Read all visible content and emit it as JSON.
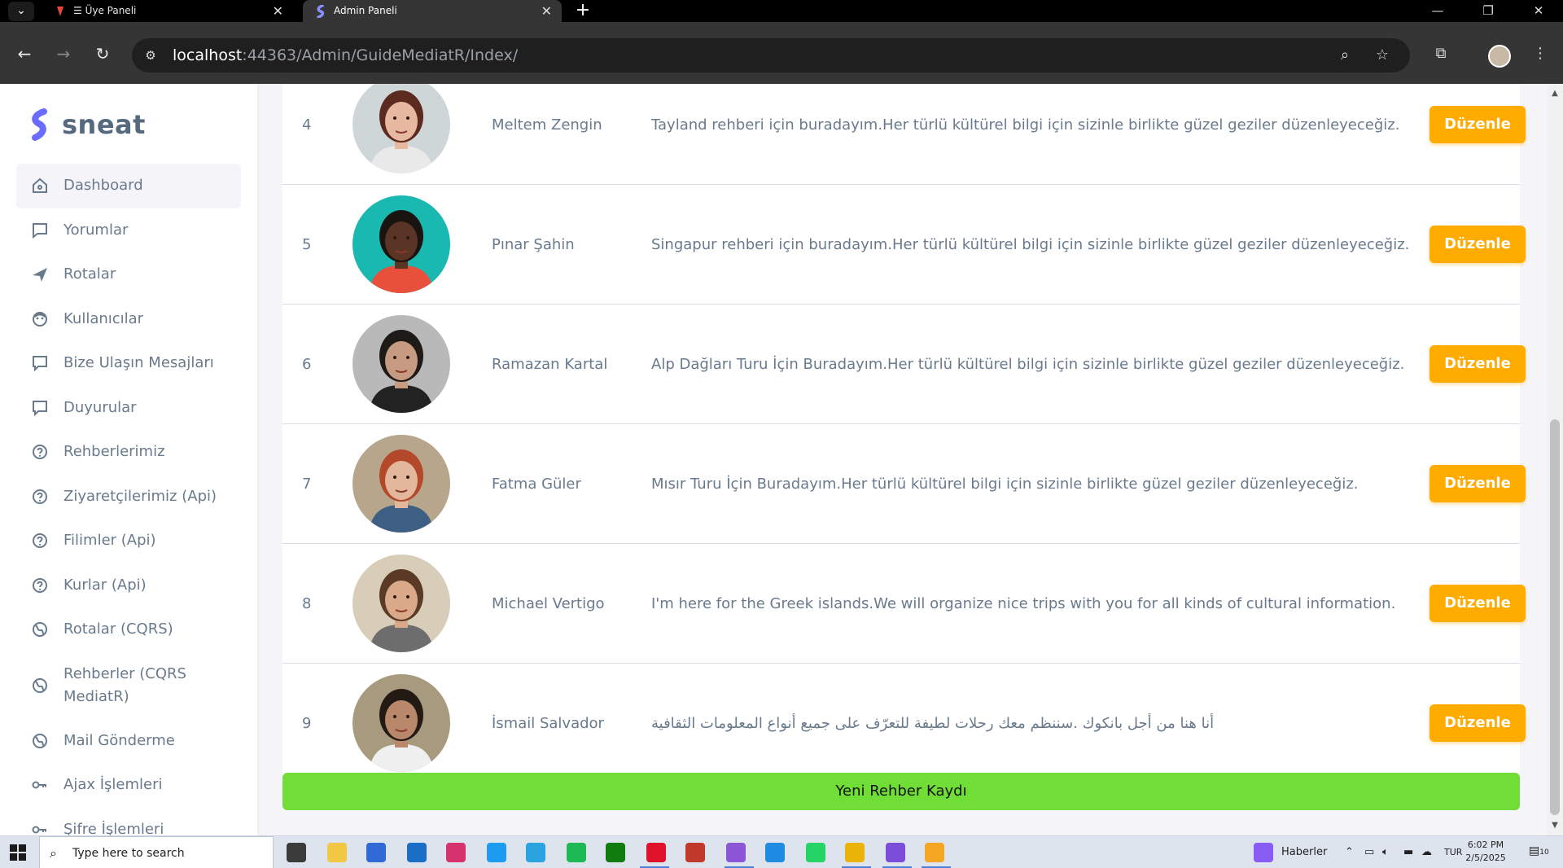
{
  "browser": {
    "tabs": [
      {
        "title": "☰ Üye Paneli",
        "active": false
      },
      {
        "title": "Admin Paneli",
        "active": true
      }
    ],
    "url_host": "localhost",
    "url_rest": ":44363/Admin/GuideMediatR/Index/"
  },
  "brand": {
    "name": "sneat",
    "color": "#696cff"
  },
  "sidebar": {
    "items": [
      {
        "label": "Dashboard",
        "icon": "home-icon",
        "active": true
      },
      {
        "label": "Yorumlar",
        "icon": "comment-icon"
      },
      {
        "label": "Rotalar",
        "icon": "plane-icon"
      },
      {
        "label": "Kullanıcılar",
        "icon": "user-face-icon"
      },
      {
        "label": "Bize Ulaşın Mesajları",
        "icon": "message-square-icon"
      },
      {
        "label": "Duyurular",
        "icon": "message-square-icon"
      },
      {
        "label": "Rehberlerimiz",
        "icon": "help-circle-icon"
      },
      {
        "label": "Ziyaretçilerimiz (Api)",
        "icon": "help-circle-icon"
      },
      {
        "label": "Filimler (Api)",
        "icon": "help-circle-icon"
      },
      {
        "label": "Kurlar (Api)",
        "icon": "help-circle-icon"
      },
      {
        "label": "Rotalar (CQRS)",
        "icon": "globe-icon"
      },
      {
        "label": "Rehberler (CQRS MediatR)",
        "icon": "globe-icon"
      },
      {
        "label": "Mail Gönderme",
        "icon": "globe-icon"
      },
      {
        "label": "Ajax İşlemleri",
        "icon": "key-icon"
      },
      {
        "label": "Şifre İşlemleri",
        "icon": "key-icon"
      }
    ]
  },
  "guides": [
    {
      "id": "4",
      "name": "Meltem Zengin",
      "description": "Tayland rehberi için buradayım.Her türlü kültürel bilgi için sizinle birlikte güzel geziler düzenleyeceğiz.",
      "edit_label": "Düzenle",
      "avatar": {
        "bg": "#cfd6d8",
        "skin": "#e7b9a1",
        "hair": "#5a2b1e",
        "shirt": "#e9e9e9"
      }
    },
    {
      "id": "5",
      "name": "Pınar Şahin",
      "description": "Singapur rehberi için buradayım.Her türlü kültürel bilgi için sizinle birlikte güzel geziler düzenleyeceğiz.",
      "edit_label": "Düzenle",
      "avatar": {
        "bg": "#19b8b0",
        "skin": "#5a3424",
        "hair": "#1a1410",
        "shirt": "#e8503c"
      }
    },
    {
      "id": "6",
      "name": "Ramazan Kartal",
      "description": "Alp Dağları Turu İçin Buradayım.Her türlü kültürel bilgi için sizinle birlikte güzel geziler düzenleyeceğiz.",
      "edit_label": "Düzenle",
      "avatar": {
        "bg": "#b9b9b9",
        "skin": "#c79b82",
        "hair": "#1e1a18",
        "shirt": "#222222"
      }
    },
    {
      "id": "7",
      "name": "Fatma Güler",
      "description": "Mısır Turu İçin Buradayım.Her türlü kültürel bilgi için sizinle birlikte güzel geziler düzenleyeceğiz.",
      "edit_label": "Düzenle",
      "avatar": {
        "bg": "#b7a58c",
        "skin": "#e3b79c",
        "hair": "#b4482a",
        "shirt": "#3e5f84"
      }
    },
    {
      "id": "8",
      "name": "Michael Vertigo",
      "description": "I'm here for the Greek islands.We will organize nice trips with you for all kinds of cultural information.",
      "edit_label": "Düzenle",
      "avatar": {
        "bg": "#d8cdb8",
        "skin": "#d9a98a",
        "hair": "#5a3a24",
        "shirt": "#6d6d6d"
      }
    },
    {
      "id": "9",
      "name": "İsmail Salvador",
      "description": "أنا هنا من أجل بانكوك .سننظم معك رحلات لطيفة للتعرّف على جميع أنواع المعلومات الثقافية",
      "edit_label": "Düzenle",
      "rtl": true,
      "avatar": {
        "bg": "#a89a7e",
        "skin": "#b9876a",
        "hair": "#231a14",
        "shirt": "#efefef"
      }
    }
  ],
  "new_button_label": "Yeni Rehber Kaydı",
  "taskbar": {
    "search_placeholder": "Type here to search",
    "news_label": "Haberler",
    "lang": "TUR",
    "time": "6:02 PM",
    "date": "2/5/2025",
    "notif_count": "10"
  },
  "colors": {
    "edit_button": "#ffab00",
    "new_button": "#71dd37",
    "text": "#697a8d"
  }
}
